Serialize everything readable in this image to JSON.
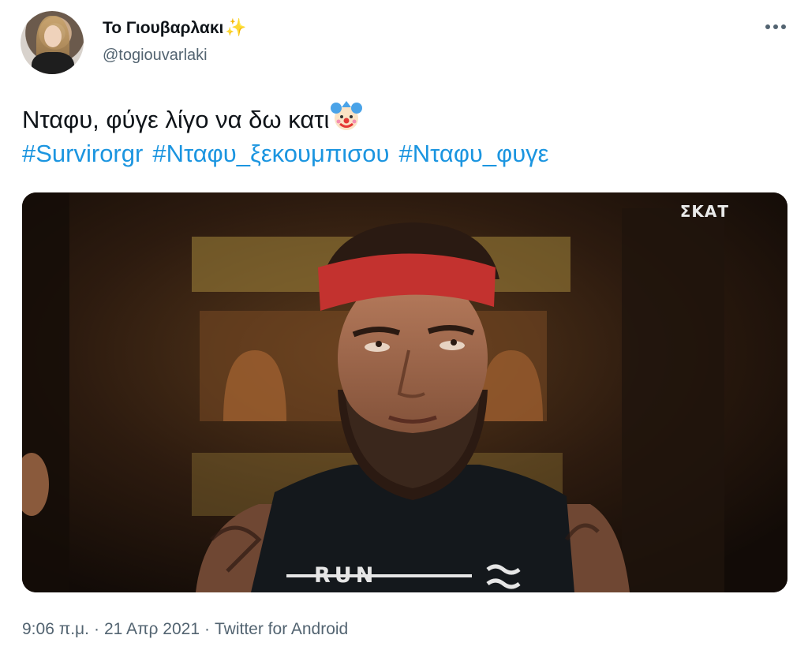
{
  "author": {
    "display_name": "Το Γιουβαρλακι",
    "emoji": "sparkles",
    "handle": "@togiouvarlaki",
    "avatar": "profile-photo"
  },
  "more_icon": "more-horizontal-icon",
  "tweet": {
    "text": "Νταφυ, φύγε λίγο να δω κατι",
    "emoji": "clown-face",
    "hashtags": [
      "#Survirorgr",
      "#Νταφυ_ξεκουμπισου",
      "#Νταφυ_φυγε"
    ]
  },
  "media": {
    "type": "video-still",
    "watermark": "ΣΚΑΤ",
    "shirt_text": "RUN"
  },
  "meta": {
    "time": "9:06 π.μ.",
    "date": "21 Απρ 2021",
    "source": "Twitter for Android",
    "separator": "·"
  },
  "colors": {
    "link": "#1b95e0",
    "secondary_text": "#536471",
    "primary_text": "#0f1419"
  }
}
